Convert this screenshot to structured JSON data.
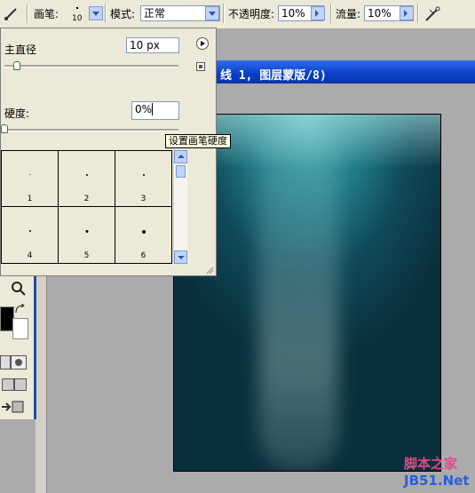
{
  "options_bar": {
    "brush_label": "画笔:",
    "brush_size": "10",
    "mode_label": "模式:",
    "mode_value": "正常",
    "opacity_label": "不透明度:",
    "opacity_value": "10%",
    "flow_label": "流量:",
    "flow_value": "10%"
  },
  "document": {
    "title": "线 1, 图层蒙版/8)"
  },
  "brush_panel": {
    "diameter_label": "主直径",
    "diameter_value": "10 px",
    "diameter_level": 0.05,
    "hardness_label": "硬度:",
    "hardness_value": "0%",
    "hardness_level": 0.0,
    "tooltip": "设置画笔硬度",
    "presets": [
      {
        "label": "1"
      },
      {
        "label": "2"
      },
      {
        "label": "3"
      },
      {
        "label": "4"
      },
      {
        "label": "5"
      },
      {
        "label": "6"
      }
    ]
  },
  "watermark": {
    "line1": "脚本之家",
    "line2": "JB51.Net"
  },
  "colors": {
    "title_bar": "#0a3fc4",
    "panel_bg": "#ece9d8",
    "workspace": "#ababab"
  }
}
